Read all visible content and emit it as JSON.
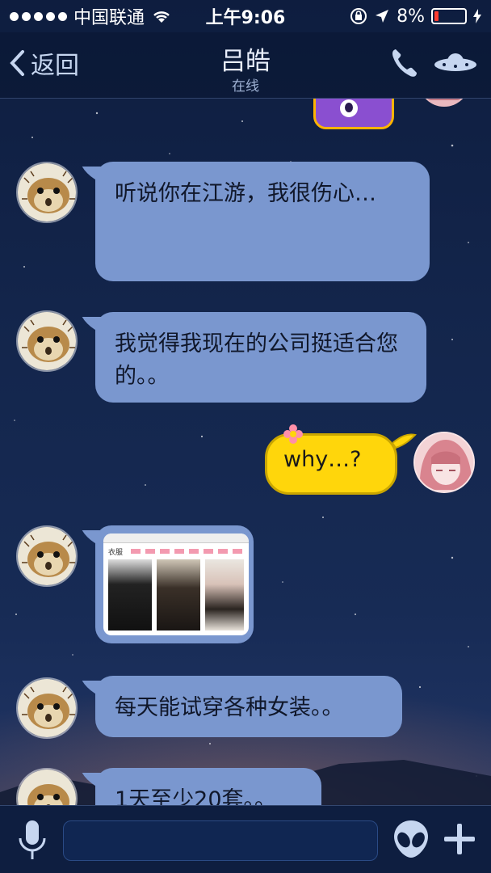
{
  "status_bar": {
    "carrier": "中国联通",
    "time": "上午9:06",
    "battery_percent": "8%"
  },
  "nav": {
    "back_label": "返回",
    "title": "吕皓",
    "subtitle": "在线"
  },
  "messages": [
    {
      "type": "text",
      "side": "left",
      "text": "听说你在江游，我很伤心…"
    },
    {
      "type": "text",
      "side": "left",
      "text": "我觉得我现在的公司挺适合您的。。"
    },
    {
      "type": "text",
      "side": "right",
      "text": "why…?"
    },
    {
      "type": "image",
      "side": "left",
      "image_label": "衣服"
    },
    {
      "type": "text",
      "side": "left",
      "text": "每天能试穿各种女装。。"
    },
    {
      "type": "text",
      "side": "left",
      "text": "1天至少20套。。"
    }
  ],
  "input": {
    "placeholder": ""
  },
  "icons": {
    "back": "chevron-left-icon",
    "phone": "phone-icon",
    "ufo": "ufo-icon",
    "mic": "microphone-icon",
    "alien": "alien-emoji-icon",
    "plus": "plus-icon"
  },
  "colors": {
    "bubble_left": "#7a97cf",
    "bubble_right": "#ffd60b",
    "nav_text": "#c6d6f0",
    "battery_low": "#ff3b30"
  }
}
